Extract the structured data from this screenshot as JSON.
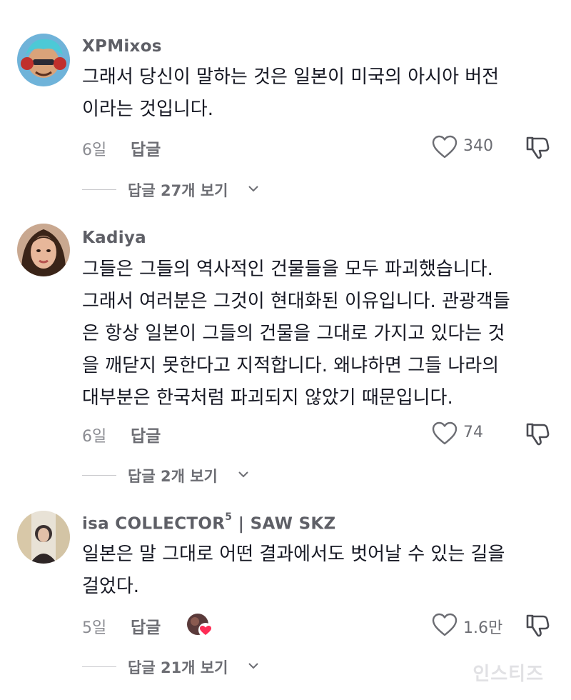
{
  "comments": [
    {
      "username": "XPMixos",
      "username_sup": "",
      "text": "그래서 당신이 말하는 것은 일본이 미국의 아시아 버전\n이라는 것입니다.",
      "age": "6일",
      "reply_label": "답글",
      "likes": "340",
      "view_replies": "답글 27개 보기"
    },
    {
      "username": "Kadiya",
      "username_sup": "",
      "text": "그들은 그들의 역사적인 건물들을 모두 파괴했습니다.\n그래서 여러분은 그것이 현대화된 이유입니다. 관광객들\n은 항상 일본이 그들의 건물을 그대로 가지고 있다는 것\n을 깨닫지 못한다고 지적합니다. 왜냐하면 그들 나라의\n대부분은 한국처럼 파괴되지 않았기 때문입니다.",
      "age": "6일",
      "reply_label": "답글",
      "likes": "74",
      "view_replies": "답글 2개 보기"
    },
    {
      "username": "isa COLLECTOR",
      "username_sup": "5",
      "username_suffix": " | SAW SKZ",
      "text": "일본은 말 그대로 어떤 결과에서도 벗어날 수 있는 길을\n걸었다.",
      "age": "5일",
      "reply_label": "답글",
      "likes": "1.6만",
      "view_replies": "답글 21개 보기"
    }
  ],
  "watermark": "인스티즈",
  "colors": {
    "text": "#161823",
    "secondary": "#6c6d73",
    "muted": "#8a8b91",
    "creator_heart": "#fe2c55"
  },
  "icons": [
    "heart-outline-icon",
    "dislike-icon",
    "chevron-down-icon",
    "creator-liked-heart-icon"
  ]
}
